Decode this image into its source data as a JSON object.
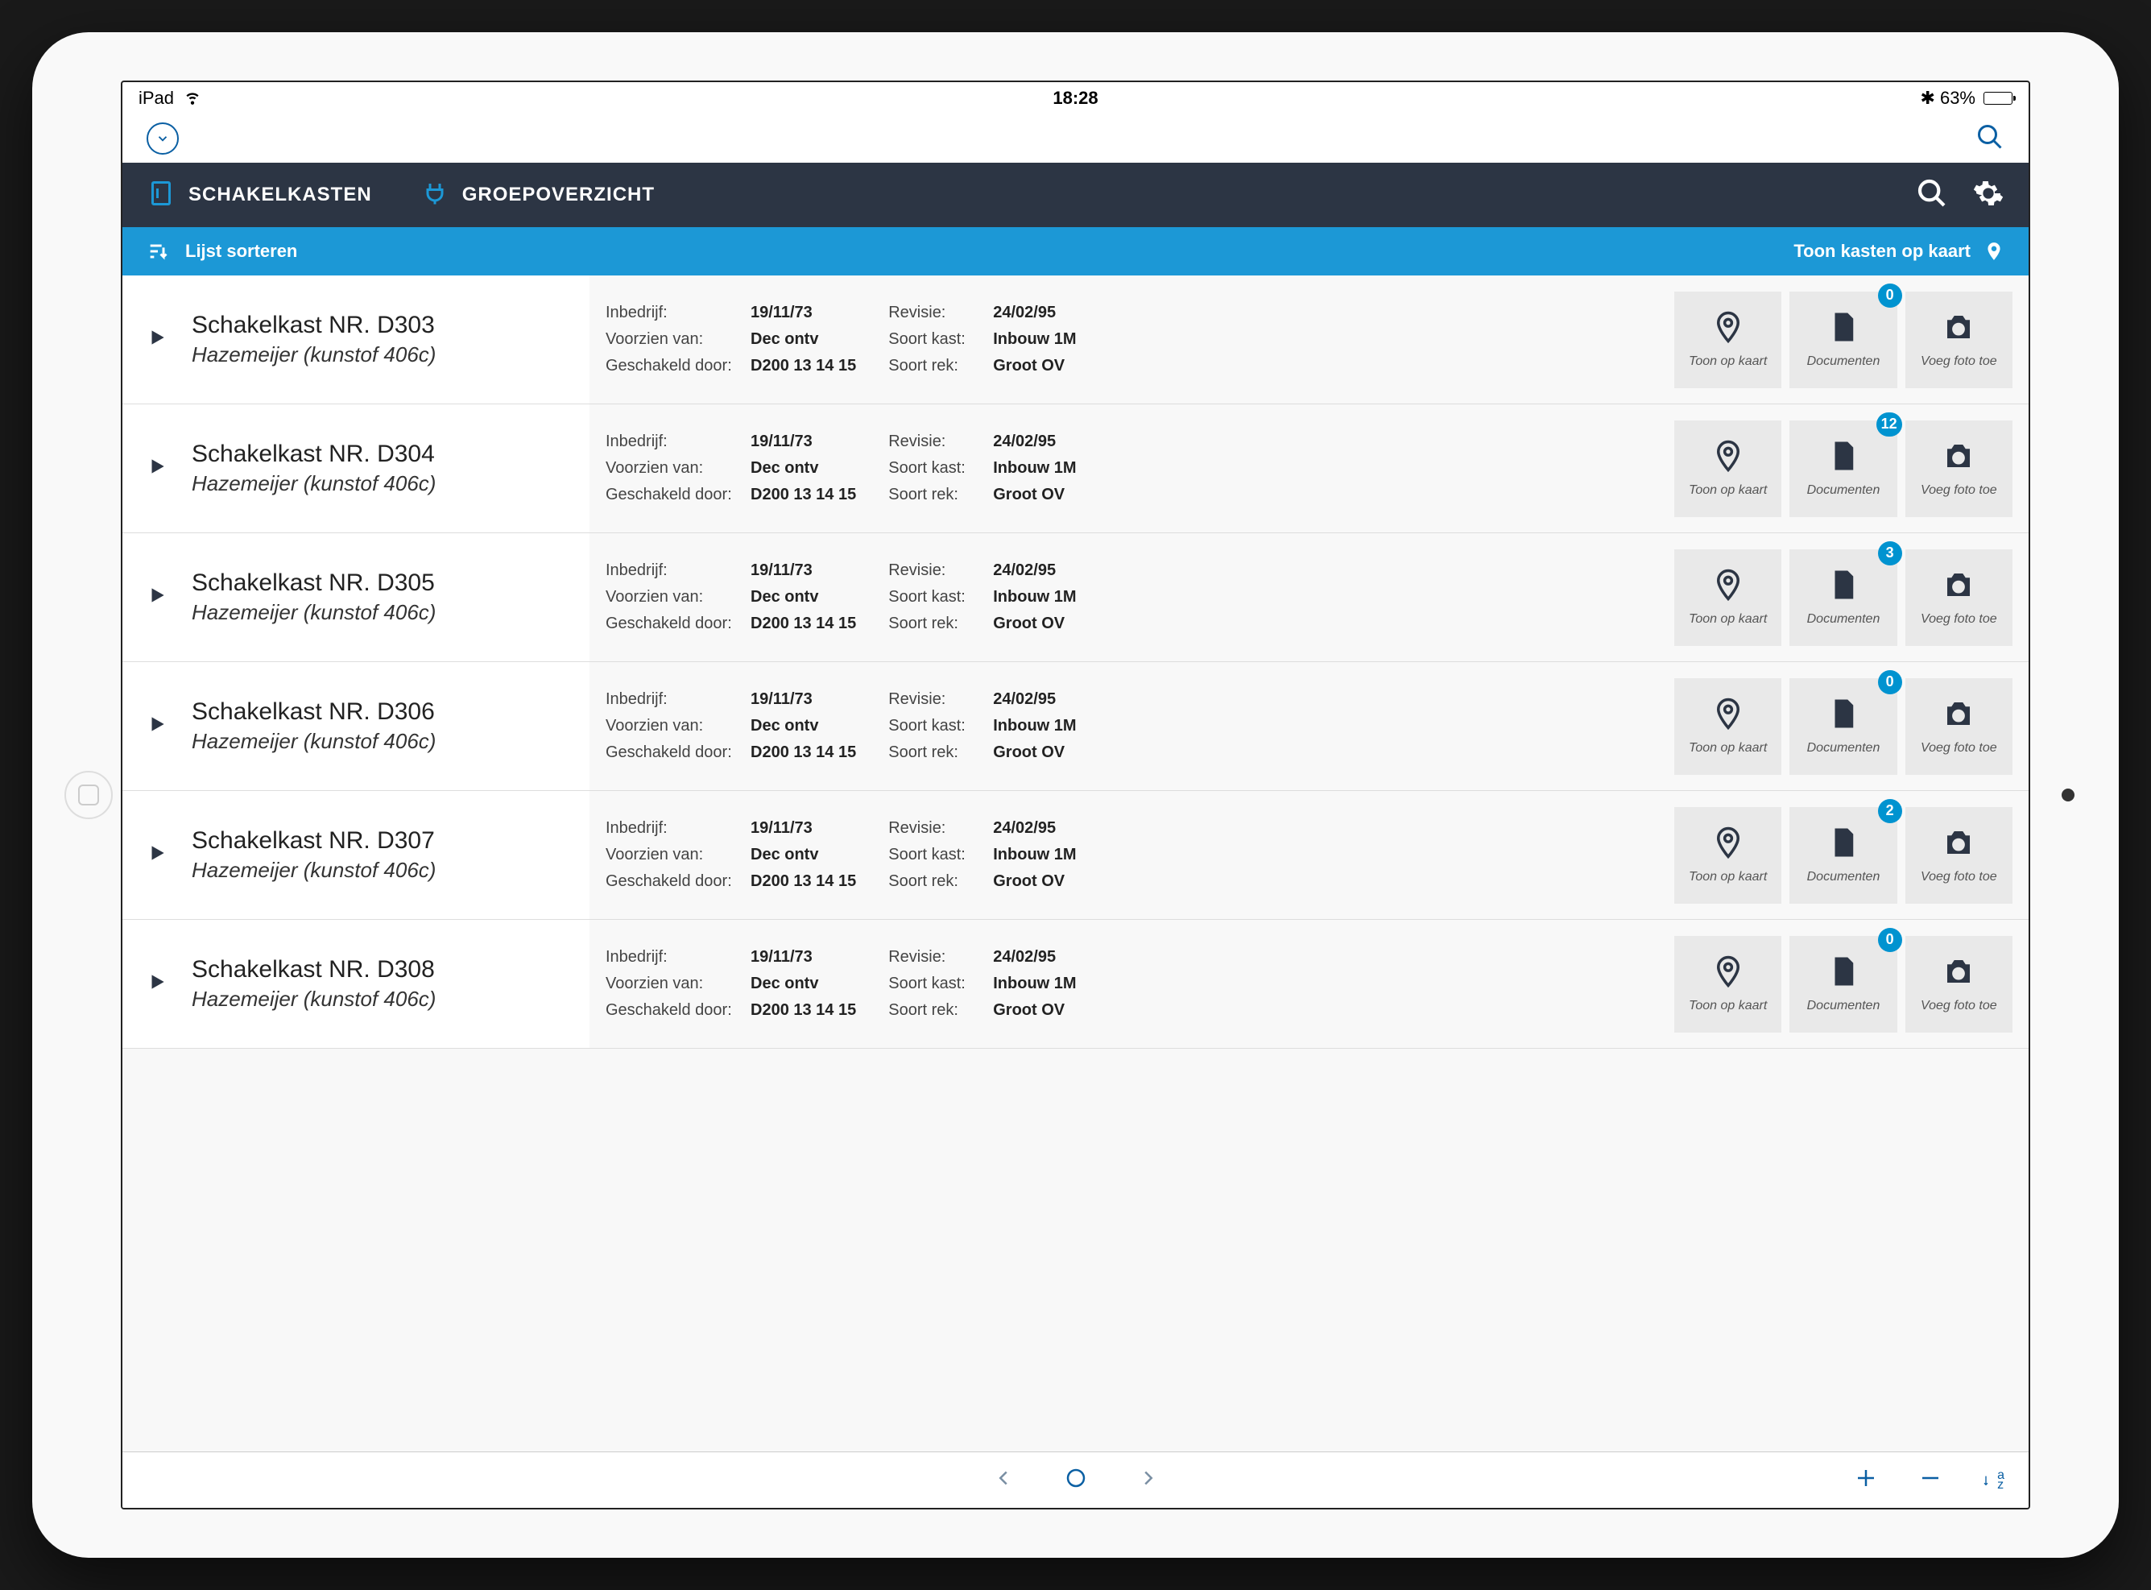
{
  "status_bar": {
    "device": "iPad",
    "time": "18:28",
    "battery": "63%"
  },
  "toolbar": {
    "chevron": "⌄",
    "search": "🔍"
  },
  "nav": {
    "tab1": "SCHAKELKASTEN",
    "tab2": "GROEPOVERZICHT"
  },
  "sort_bar": {
    "sort_label": "Lijst sorteren",
    "map_label": "Toon kasten op kaart"
  },
  "action_labels": {
    "map": "Toon op kaart",
    "docs": "Documenten",
    "photo": "Voeg foto toe"
  },
  "field_labels": {
    "inbedrijf": "Inbedrijf:",
    "voorzien": "Voorzien van:",
    "geschakeld": "Geschakeld door:",
    "revisie": "Revisie:",
    "soort_kast": "Soort kast:",
    "soort_rek": "Soort rek:"
  },
  "rows": [
    {
      "title": "Schakelkast NR. D303",
      "sub": "Hazemeijer (kunstof 406c)",
      "inbedrijf": "19/11/73",
      "voorzien": "Dec ontv",
      "geschakeld": "D200 13 14 15",
      "revisie": "24/02/95",
      "soort_kast": "Inbouw 1M",
      "soort_rek": "Groot OV",
      "docs_count": "0"
    },
    {
      "title": "Schakelkast NR. D304",
      "sub": "Hazemeijer (kunstof 406c)",
      "inbedrijf": "19/11/73",
      "voorzien": "Dec ontv",
      "geschakeld": "D200 13 14 15",
      "revisie": "24/02/95",
      "soort_kast": "Inbouw 1M",
      "soort_rek": "Groot OV",
      "docs_count": "12"
    },
    {
      "title": "Schakelkast NR. D305",
      "sub": "Hazemeijer (kunstof 406c)",
      "inbedrijf": "19/11/73",
      "voorzien": "Dec ontv",
      "geschakeld": "D200 13 14 15",
      "revisie": "24/02/95",
      "soort_kast": "Inbouw 1M",
      "soort_rek": "Groot OV",
      "docs_count": "3"
    },
    {
      "title": "Schakelkast NR. D306",
      "sub": "Hazemeijer (kunstof 406c)",
      "inbedrijf": "19/11/73",
      "voorzien": "Dec ontv",
      "geschakeld": "D200 13 14 15",
      "revisie": "24/02/95",
      "soort_kast": "Inbouw 1M",
      "soort_rek": "Groot OV",
      "docs_count": "0"
    },
    {
      "title": "Schakelkast NR. D307",
      "sub": "Hazemeijer (kunstof 406c)",
      "inbedrijf": "19/11/73",
      "voorzien": "Dec ontv",
      "geschakeld": "D200 13 14 15",
      "revisie": "24/02/95",
      "soort_kast": "Inbouw 1M",
      "soort_rek": "Groot OV",
      "docs_count": "2"
    },
    {
      "title": "Schakelkast NR. D308",
      "sub": "Hazemeijer (kunstof 406c)",
      "inbedrijf": "19/11/73",
      "voorzien": "Dec ontv",
      "geschakeld": "D200 13 14 15",
      "revisie": "24/02/95",
      "soort_kast": "Inbouw 1M",
      "soort_rek": "Groot OV",
      "docs_count": "0"
    }
  ],
  "bottom_bar": {
    "az": "a\nz"
  }
}
